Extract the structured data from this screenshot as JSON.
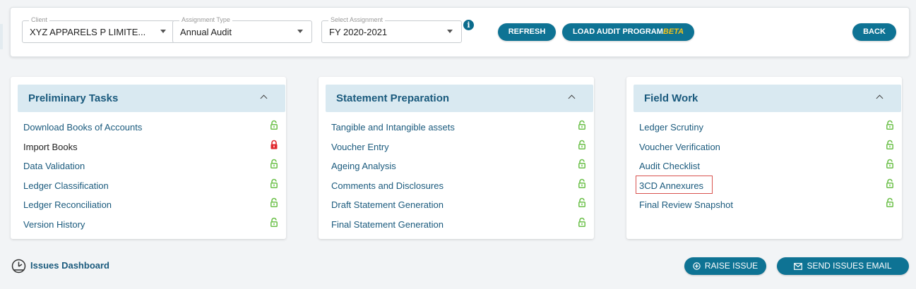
{
  "filters": {
    "client": {
      "label": "Client",
      "value": "XYZ APPARELS P LIMITE..."
    },
    "assignment_type": {
      "label": "Assignment Type",
      "value": "Annual Audit"
    },
    "select_assignment": {
      "label": "Select Assignment",
      "value": "FY 2020-2021"
    }
  },
  "toolbar": {
    "refresh_label": "REFRESH",
    "load_audit_label": "LOAD AUDIT PROGRAM",
    "beta_label": "BETA",
    "back_label": "BACK"
  },
  "cards": [
    {
      "title": "Preliminary Tasks",
      "items": [
        {
          "label": "Download Books of Accounts",
          "lock": "unlocked"
        },
        {
          "label": "Import Books",
          "lock": "locked"
        },
        {
          "label": "Data Validation",
          "lock": "unlocked"
        },
        {
          "label": "Ledger Classification",
          "lock": "unlocked"
        },
        {
          "label": "Ledger Reconciliation",
          "lock": "unlocked"
        },
        {
          "label": "Version History",
          "lock": "unlocked"
        }
      ]
    },
    {
      "title": "Statement Preparation",
      "items": [
        {
          "label": "Tangible and Intangible assets",
          "lock": "unlocked"
        },
        {
          "label": "Voucher Entry",
          "lock": "unlocked"
        },
        {
          "label": "Ageing Analysis",
          "lock": "unlocked"
        },
        {
          "label": "Comments and Disclosures",
          "lock": "unlocked"
        },
        {
          "label": "Draft Statement Generation",
          "lock": "unlocked"
        },
        {
          "label": "Final Statement Generation",
          "lock": "unlocked"
        }
      ]
    },
    {
      "title": "Field Work",
      "items": [
        {
          "label": "Ledger Scrutiny",
          "lock": "unlocked"
        },
        {
          "label": "Voucher Verification",
          "lock": "unlocked"
        },
        {
          "label": "Audit Checklist",
          "lock": "unlocked"
        },
        {
          "label": "3CD Annexures",
          "lock": "unlocked"
        },
        {
          "label": "Final Review Snapshot",
          "lock": "unlocked"
        }
      ]
    }
  ],
  "footer": {
    "issues_dashboard_label": "Issues Dashboard",
    "raise_issue_label": "RAISE ISSUE",
    "send_email_label": "SEND ISSUES EMAIL"
  },
  "colors": {
    "accent": "#0e7394",
    "unlocked": "#6cc04a",
    "locked": "#e0282e",
    "card_header": "#d9e9f1"
  }
}
